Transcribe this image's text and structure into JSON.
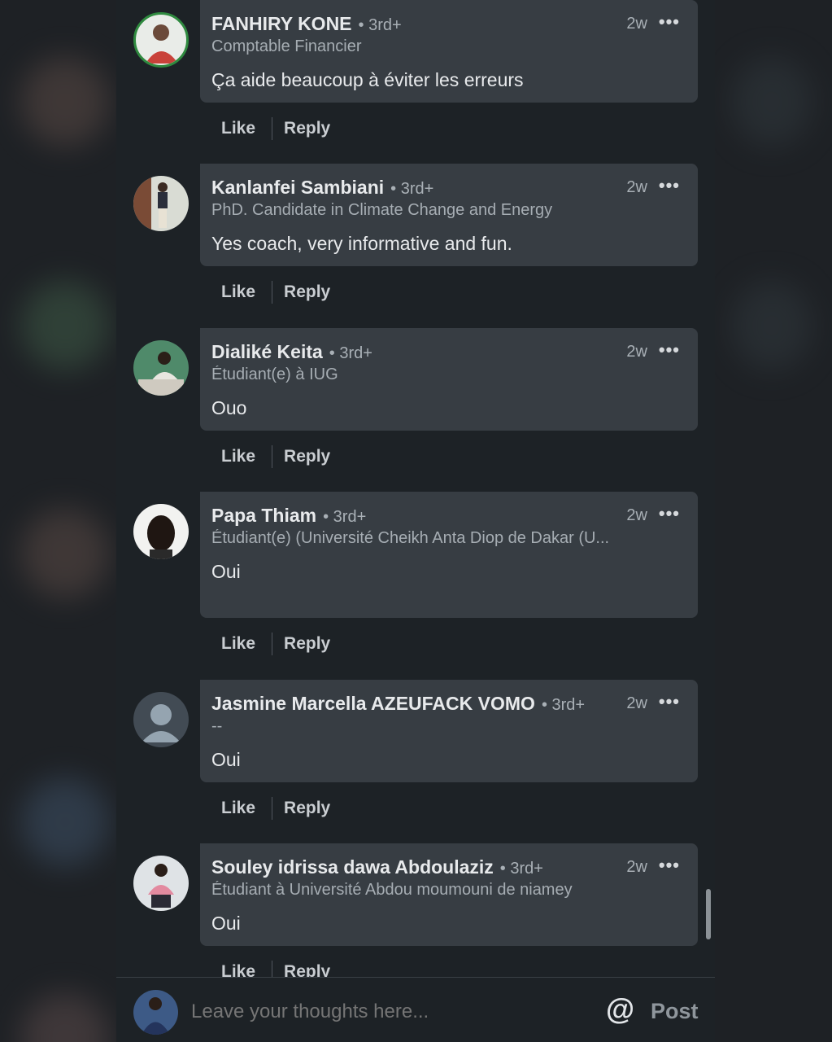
{
  "comments": [
    {
      "name": "FANHIRY KONE",
      "degree": "• 3rd+",
      "time": "2w",
      "more": "•••",
      "headline": "Comptable Financier",
      "text": "Ça aide beaucoup à éviter les erreurs",
      "like": "Like",
      "reply": "Reply"
    },
    {
      "name": "Kanlanfei Sambiani",
      "degree": "• 3rd+",
      "time": "2w",
      "more": "•••",
      "headline": "PhD. Candidate in Climate Change and Energy",
      "text": "Yes coach, very informative and fun.",
      "like": "Like",
      "reply": "Reply"
    },
    {
      "name": "Dialiké Keita",
      "degree": "• 3rd+",
      "time": "2w",
      "more": "•••",
      "headline": "Étudiant(e) à IUG",
      "text": "Ouo",
      "like": "Like",
      "reply": "Reply"
    },
    {
      "name": "Papa Thiam",
      "degree": "• 3rd+",
      "time": "2w",
      "more": "•••",
      "headline": "Étudiant(e) (Université Cheikh Anta Diop de Dakar (U...",
      "text": "Oui",
      "like": "Like",
      "reply": "Reply"
    },
    {
      "name": "Jasmine Marcella AZEUFACK VOMO",
      "degree": "• 3rd+",
      "time": "2w",
      "more": "•••",
      "headline": "--",
      "text": "Oui",
      "like": "Like",
      "reply": "Reply"
    },
    {
      "name": "Souley idrissa dawa Abdoulaziz",
      "degree": "• 3rd+",
      "time": "2w",
      "more": "•••",
      "headline": "Étudiant à Université Abdou moumouni de niamey",
      "text": "Oui",
      "like": "Like",
      "reply": "Reply"
    }
  ],
  "composer": {
    "placeholder": "Leave your thoughts here...",
    "at_symbol": "@",
    "post_label": "Post"
  },
  "colors": {
    "background": "#1d2226",
    "bubble": "#373d43",
    "text": "#e8eaec",
    "muted": "#a9b0b6"
  }
}
